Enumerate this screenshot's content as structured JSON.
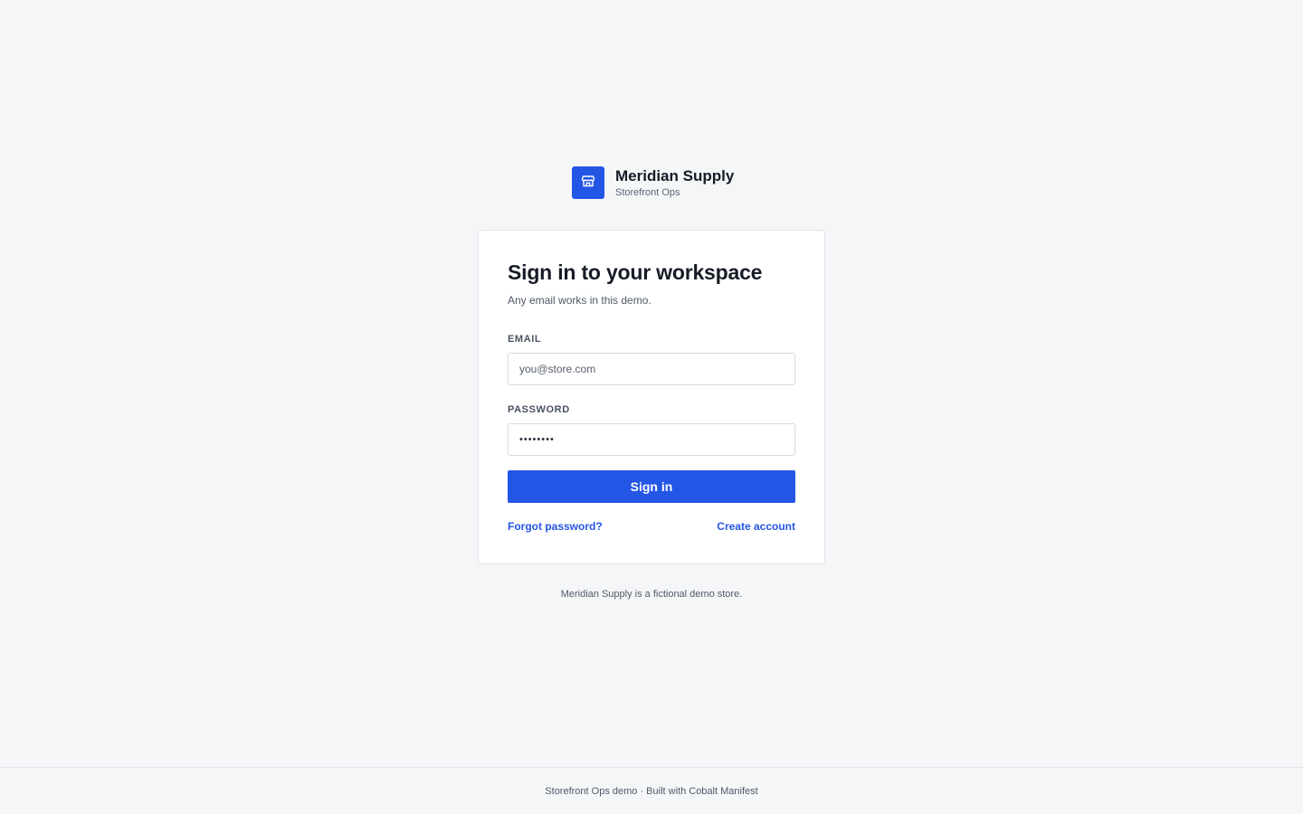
{
  "brand": {
    "name": "Meridian Supply",
    "subtitle": "Storefront Ops",
    "logo_icon": "storefront-icon",
    "accent_color": "#2456e6"
  },
  "login": {
    "title": "Sign in to your workspace",
    "subtitle": "Any email works in this demo.",
    "email": {
      "label": "EMAIL",
      "placeholder": "you@store.com",
      "value": ""
    },
    "password": {
      "label": "PASSWORD",
      "value": "••••••••"
    },
    "submit_label": "Sign in",
    "forgot_label": "Forgot password?",
    "create_label": "Create account"
  },
  "disclaimer": "Meridian Supply is a fictional demo store.",
  "footer": {
    "text": "Storefront Ops demo · Built with Cobalt Manifest"
  }
}
